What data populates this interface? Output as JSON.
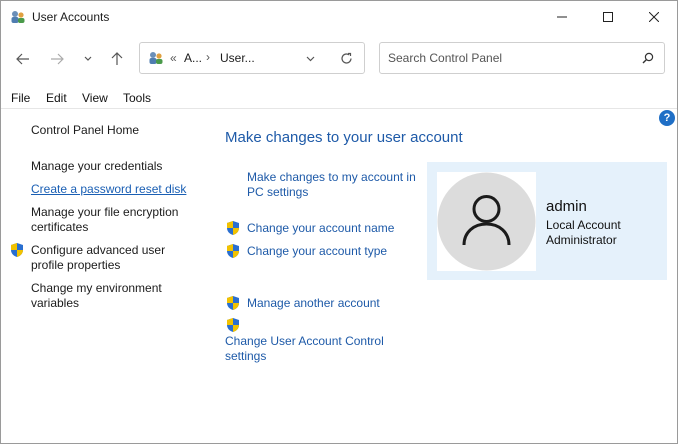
{
  "window": {
    "title": "User Accounts"
  },
  "nav": {
    "breadcrumb": [
      "«",
      "A...",
      "›",
      "User..."
    ],
    "search_placeholder": "Search Control Panel"
  },
  "menu": [
    "File",
    "Edit",
    "View",
    "Tools"
  ],
  "left_pane": {
    "home": "Control Panel Home",
    "links": [
      "Manage your credentials",
      "Create a password reset disk",
      "Manage your file encryption certificates",
      "Configure advanced user profile properties",
      "Change my environment variables"
    ]
  },
  "main": {
    "heading": "Make changes to your user account",
    "tasks": [
      "Make changes to my account in PC settings",
      "Change your account name",
      "Change your account type",
      "Manage another account",
      "Change User Account Control settings"
    ]
  },
  "account": {
    "name": "admin",
    "type": "Local Account",
    "role": "Administrator"
  },
  "help": {
    "label": "?"
  },
  "colors": {
    "link": "#1e5aa8",
    "card": "#e5f1fb",
    "help": "#1f6fc6"
  }
}
